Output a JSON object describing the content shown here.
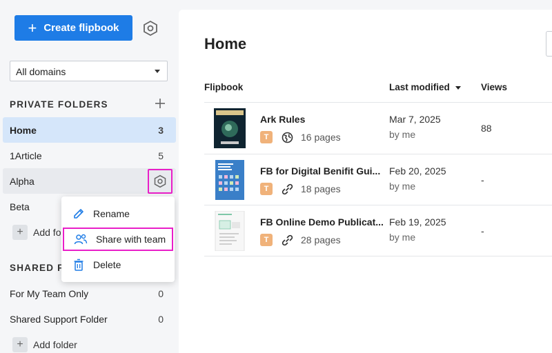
{
  "sidebar": {
    "create_label": "Create flipbook",
    "create_icon": "plus-icon",
    "domain_select_value": "All domains",
    "private_title": "PRIVATE FOLDERS",
    "private_folders": [
      {
        "label": "Home",
        "count": "3"
      },
      {
        "label": "1Article",
        "count": "5"
      },
      {
        "label": "Alpha",
        "count": ""
      },
      {
        "label": "Beta",
        "count": ""
      }
    ],
    "add_folder_partial": "Add fol",
    "shared_title_partial": "SHARED FO",
    "shared_folders": [
      {
        "label": "For My Team Only",
        "count": "0"
      },
      {
        "label": "Shared Support Folder",
        "count": "0"
      }
    ],
    "add_folder_label": "Add folder"
  },
  "context_menu": {
    "items": [
      {
        "label": "Rename",
        "icon": "pencil-icon"
      },
      {
        "label": "Share with team",
        "icon": "people-icon"
      },
      {
        "label": "Delete",
        "icon": "trash-icon"
      }
    ]
  },
  "main": {
    "title": "Home",
    "columns": {
      "flipbook": "Flipbook",
      "last_modified": "Last modified",
      "views": "Views"
    },
    "rows": [
      {
        "title": "Ark Rules",
        "badge": "T",
        "visibility_icon": "globe-icon",
        "pages": "16 pages",
        "date": "Mar 7, 2025",
        "by": "by me",
        "views": "88"
      },
      {
        "title": "FB for Digital Benifit Gui...",
        "badge": "T",
        "visibility_icon": "link-icon",
        "pages": "18 pages",
        "date": "Feb 20, 2025",
        "by": "by me",
        "views": "-"
      },
      {
        "title": "FB Online Demo Publicat...",
        "badge": "T",
        "visibility_icon": "link-icon",
        "pages": "28 pages",
        "date": "Feb 19, 2025",
        "by": "by me",
        "views": "-"
      }
    ]
  },
  "colors": {
    "accent": "#1e7ce6",
    "highlight": "#e91ec8",
    "active_folder": "#d5e6fa",
    "badge": "#f0b27a"
  }
}
